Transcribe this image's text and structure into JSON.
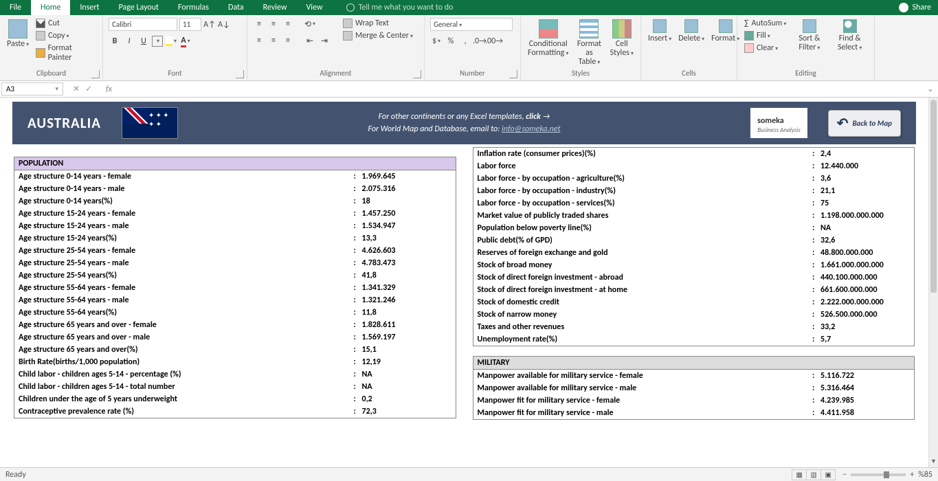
{
  "titlebar": {
    "tabs": [
      "File",
      "Home",
      "Insert",
      "Page Layout",
      "Formulas",
      "Data",
      "Review",
      "View"
    ],
    "active": 1,
    "tellme": "Tell me what you want to do",
    "share": "Share"
  },
  "ribbon": {
    "clipboard": {
      "label": "Clipboard",
      "paste": "Paste",
      "cut": "Cut",
      "copy": "Copy",
      "fp": "Format Painter"
    },
    "font": {
      "label": "Font",
      "name": "Calibri",
      "size": "11"
    },
    "alignment": {
      "label": "Alignment",
      "wrap": "Wrap Text",
      "merge": "Merge & Center"
    },
    "number": {
      "label": "Number",
      "fmt": "General"
    },
    "styles": {
      "label": "Styles",
      "cf": "Conditional Formatting",
      "fat": "Format as Table",
      "cs": "Cell Styles"
    },
    "cells": {
      "label": "Cells",
      "ins": "Insert",
      "del": "Delete",
      "fmt": "Format"
    },
    "editing": {
      "label": "Editing",
      "sum": "AutoSum",
      "fill": "Fill",
      "clear": "Clear",
      "sf": "Sort & Filter",
      "fs": "Find & Select"
    }
  },
  "namebox": {
    "cell": "A3"
  },
  "header": {
    "country": "AUSTRALIA",
    "line1": "For other continents or any Excel templates,",
    "click": "click",
    "line2": "For World Map and Database, email to:",
    "email": "info@someka.net",
    "logo": "someka",
    "logosub": "Business Analysis",
    "back": "Back to Map"
  },
  "left": {
    "section": "POPULATION",
    "rows": [
      {
        "l": "Age structure 0-14 years - female",
        "v": "1.969.645"
      },
      {
        "l": "Age structure 0-14 years - male",
        "v": "2.075.316"
      },
      {
        "l": "Age structure 0-14 years(%)",
        "v": "18"
      },
      {
        "l": "Age structure 15-24 years - female",
        "v": "1.457.250"
      },
      {
        "l": "Age structure 15-24 years - male",
        "v": "1.534.947"
      },
      {
        "l": "Age structure 15-24 years(%)",
        "v": "13,3"
      },
      {
        "l": "Age structure 25-54 years - female",
        "v": "4.626.603"
      },
      {
        "l": "Age structure 25-54 years - male",
        "v": "4.783.473"
      },
      {
        "l": "Age structure 25-54 years(%)",
        "v": "41,8"
      },
      {
        "l": "Age structure 55-64 years - female",
        "v": "1.341.329"
      },
      {
        "l": "Age structure 55-64 years - male",
        "v": "1.321.246"
      },
      {
        "l": "Age structure 55-64 years(%)",
        "v": "11,8"
      },
      {
        "l": "Age structure 65 years and over - female",
        "v": "1.828.611"
      },
      {
        "l": "Age structure 65 years and over - male",
        "v": "1.569.197"
      },
      {
        "l": "Age structure 65 years and over(%)",
        "v": "15,1"
      },
      {
        "l": "Birth Rate(births/1,000 population)",
        "v": "12,19"
      },
      {
        "l": "Child labor - children ages 5-14 - percentage (%)",
        "v": "NA"
      },
      {
        "l": "Child labor - children ages 5-14 - total number",
        "v": "NA"
      },
      {
        "l": "Children under the age of 5 years underweight",
        "v": "0,2"
      },
      {
        "l": "Contraceptive prevalence rate (%)",
        "v": "72,3"
      }
    ]
  },
  "right_top": [
    {
      "l": "Inflation rate (consumer prices)(%)",
      "v": "2,4"
    },
    {
      "l": "Labor force",
      "v": "12.440.000"
    },
    {
      "l": "Labor force - by occupation - agriculture(%)",
      "v": "3,6"
    },
    {
      "l": "Labor force - by occupation - industry(%)",
      "v": "21,1"
    },
    {
      "l": "Labor force - by occupation - services(%)",
      "v": "75"
    },
    {
      "l": "Market value of publicly traded shares",
      "v": "1.198.000.000.000"
    },
    {
      "l": "Population below poverty line(%)",
      "v": "NA"
    },
    {
      "l": "Public debt(% of GPD)",
      "v": "32,6"
    },
    {
      "l": "Reserves of foreign exchange and gold",
      "v": "48.800.000.000"
    },
    {
      "l": "Stock of broad money",
      "v": "1.661.000.000.000"
    },
    {
      "l": "Stock of direct foreign investment - abroad",
      "v": "440.100.000.000"
    },
    {
      "l": "Stock of direct foreign investment - at home",
      "v": "661.600.000.000"
    },
    {
      "l": "Stock of domestic credit",
      "v": "2.222.000.000.000"
    },
    {
      "l": "Stock of narrow money",
      "v": "526.500.000.000"
    },
    {
      "l": "Taxes and other revenues",
      "v": "33,2"
    },
    {
      "l": "Unemployment rate(%)",
      "v": "5,7"
    }
  ],
  "right_mil": {
    "section": "MILITARY",
    "rows": [
      {
        "l": "Manpower available for military service - female",
        "v": "5.116.722"
      },
      {
        "l": "Manpower available for military service - male",
        "v": "5.316.464"
      },
      {
        "l": "Manpower fit for military service - female",
        "v": "4.239.985"
      },
      {
        "l": "Manpower fit for military service - male",
        "v": "4.411.958"
      }
    ]
  },
  "status": {
    "ready": "Ready",
    "zoom": "%85"
  }
}
